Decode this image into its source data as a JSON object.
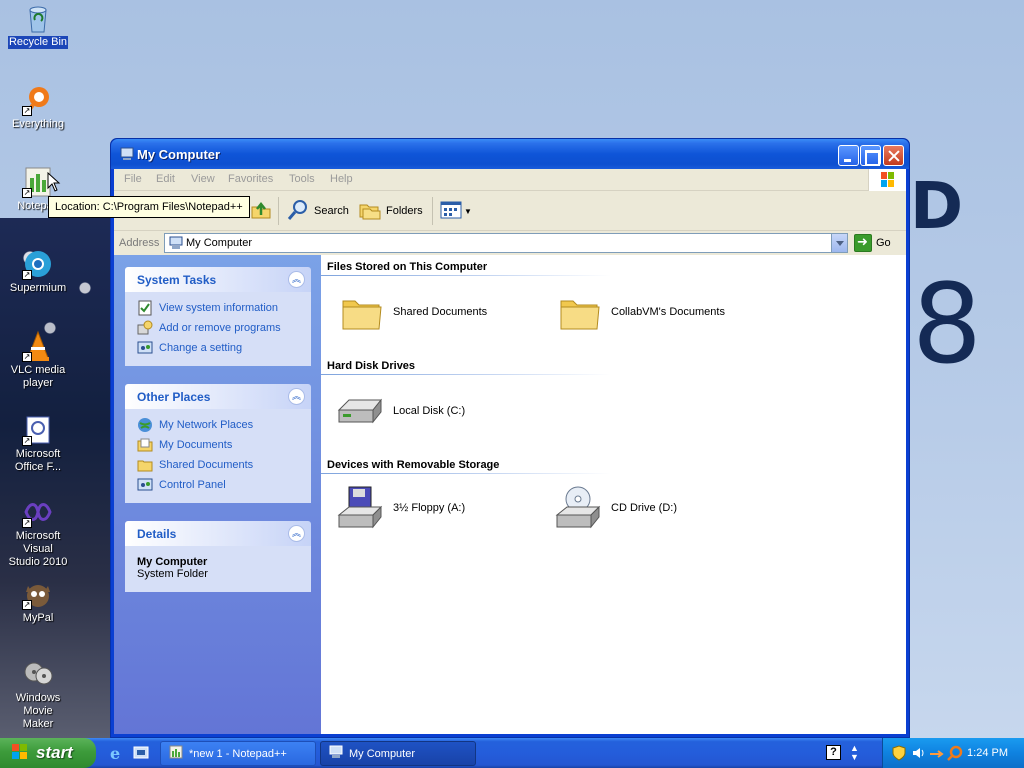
{
  "desktop": {
    "icons": [
      {
        "label": "Recycle Bin",
        "icon": "recycle-bin-icon"
      },
      {
        "label": "Everything",
        "icon": "everything-icon"
      },
      {
        "label": "Notepad++",
        "label_visible": "Notepad",
        "icon": "notepadpp-icon"
      },
      {
        "label": "Supermium",
        "icon": "supermium-icon"
      },
      {
        "label": "VLC media player",
        "line1": "VLC media",
        "line2": "player",
        "icon": "vlc-icon"
      },
      {
        "label": "Microsoft Office F...",
        "line1": "Microsoft",
        "line2": "Office F...",
        "icon": "office-icon"
      },
      {
        "label": "Microsoft Visual Studio 2010",
        "line1": "Microsoft Visual",
        "line2": "Studio 2010",
        "icon": "visual-studio-icon"
      },
      {
        "label": "MyPal",
        "icon": "mypal-icon"
      },
      {
        "label": "Windows Movie Maker",
        "line1": "Windows Movie",
        "line2": "Maker",
        "icon": "movie-maker-icon"
      }
    ],
    "art_letters": {
      "top": "D",
      "bottom": "8"
    }
  },
  "tooltip": {
    "text": "Location: C:\\Program Files\\Notepad++"
  },
  "window": {
    "title": "My Computer",
    "menu": [
      "File",
      "Edit",
      "View",
      "Favorites",
      "Tools",
      "Help"
    ],
    "toolbar": {
      "search_label": "Search",
      "folders_label": "Folders"
    },
    "address": {
      "label": "Address",
      "value": "My Computer",
      "go_label": "Go"
    },
    "taskpane": {
      "system_tasks": {
        "title": "System Tasks",
        "links": [
          "View system information",
          "Add or remove programs",
          "Change a setting"
        ]
      },
      "other_places": {
        "title": "Other Places",
        "links": [
          "My Network Places",
          "My Documents",
          "Shared Documents",
          "Control Panel"
        ]
      },
      "details": {
        "title": "Details",
        "name": "My Computer",
        "type": "System Folder"
      }
    },
    "content": {
      "groups": [
        {
          "title": "Files Stored on This Computer",
          "items": [
            "Shared Documents",
            "CollabVM's Documents"
          ]
        },
        {
          "title": "Hard Disk Drives",
          "items": [
            "Local Disk (C:)"
          ]
        },
        {
          "title": "Devices with Removable Storage",
          "items": [
            "3½ Floppy (A:)",
            "CD Drive (D:)"
          ]
        }
      ]
    }
  },
  "taskbar": {
    "start_label": "start",
    "tasks": [
      {
        "label": "*new 1 - Notepad++",
        "active": false
      },
      {
        "label": "My Computer",
        "active": true
      }
    ],
    "clock": "1:24 PM"
  },
  "colors": {
    "titlebar": "#0f55d8",
    "taskpane_link": "#215dc6",
    "start_green": "#3d9b3b",
    "tray_blue": "#0f82e0"
  }
}
